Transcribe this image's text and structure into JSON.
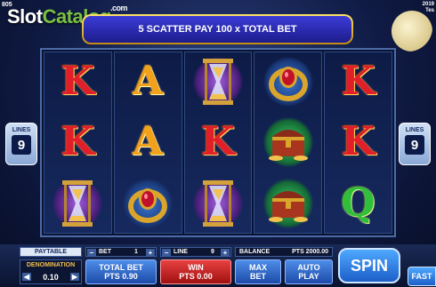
{
  "top_left_text": "805",
  "top_right_text": [
    "2019",
    "Tes"
  ],
  "logo": {
    "part1": "Slot",
    "part2": "Catalog",
    "suffix": ".com"
  },
  "banner": {
    "text": "5 SCATTER PAY 100 x TOTAL BET"
  },
  "lines_label": "LINES",
  "lines_value": "9",
  "reels": [
    [
      {
        "symbol": "K",
        "icon": "k-letter-icon"
      },
      {
        "symbol": "K",
        "icon": "k-letter-icon"
      },
      {
        "symbol": "",
        "icon": "hourglass-icon"
      }
    ],
    [
      {
        "symbol": "A",
        "icon": "a-letter-icon"
      },
      {
        "symbol": "A",
        "icon": "a-letter-icon"
      },
      {
        "symbol": "",
        "icon": "ruby-ring-icon"
      }
    ],
    [
      {
        "symbol": "",
        "icon": "hourglass-icon"
      },
      {
        "symbol": "K",
        "icon": "k-letter-icon"
      },
      {
        "symbol": "",
        "icon": "hourglass-icon"
      }
    ],
    [
      {
        "symbol": "",
        "icon": "ruby-ring-icon"
      },
      {
        "symbol": "",
        "icon": "treasure-chest-icon"
      },
      {
        "symbol": "",
        "icon": "treasure-chest-icon"
      }
    ],
    [
      {
        "symbol": "K",
        "icon": "k-letter-icon"
      },
      {
        "symbol": "K",
        "icon": "k-letter-icon"
      },
      {
        "symbol": "Q",
        "icon": "q-letter-icon"
      }
    ]
  ],
  "controls": {
    "paytable": "PAYTABLE",
    "bet_label": "BET",
    "bet_value": "1",
    "line_label": "LINE",
    "line_value": "9",
    "balance_label": "BALANCE",
    "balance_value": "PTS 2000.00",
    "denomination_label": "DENOMINATION",
    "denomination_value": "0.10",
    "total_bet_label": "TOTAL BET",
    "total_bet_value": "PTS 0.90",
    "win_label": "WIN",
    "win_value": "PTS 0.00",
    "max_bet": [
      "MAX",
      "BET"
    ],
    "auto_play": [
      "AUTO",
      "PLAY"
    ],
    "spin": "SPIN",
    "fast": "FAST"
  }
}
